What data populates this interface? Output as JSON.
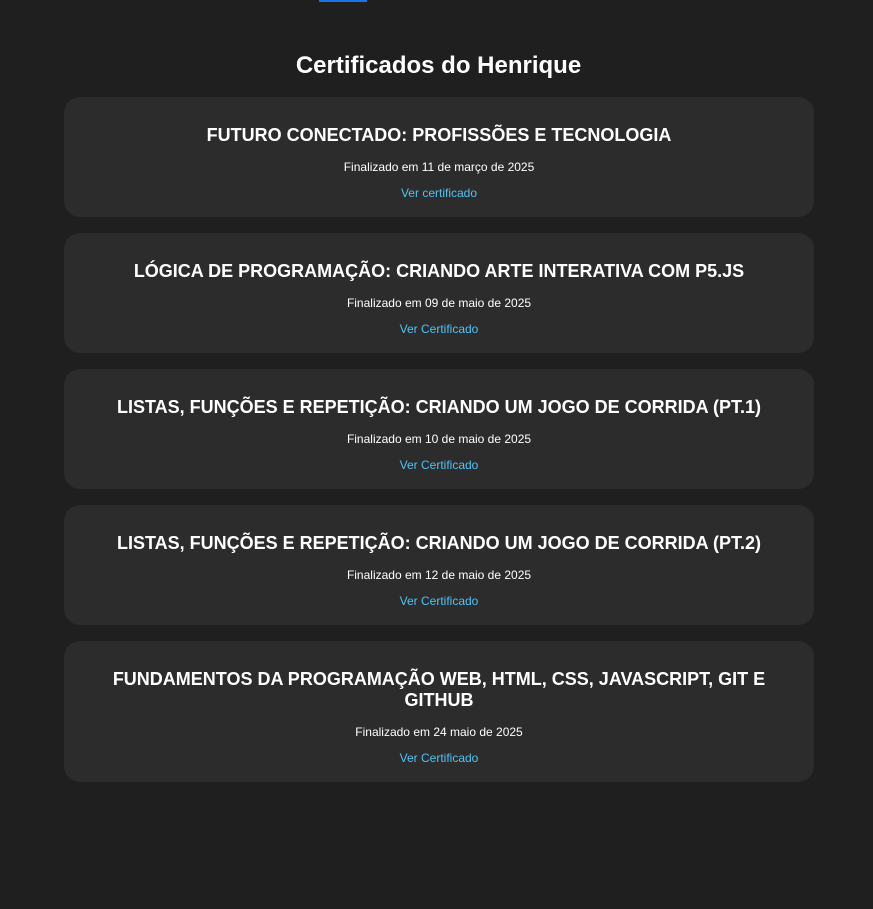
{
  "page": {
    "title": "Certificados do Henrique"
  },
  "colors": {
    "background": "#1f1f1f",
    "card": "#2c2c2c",
    "link": "#4fc3f7",
    "accent": "#1a73e8"
  },
  "certificates": [
    {
      "title": "FUTURO CONECTADO: PROFISSÕES E TECNOLOGIA",
      "date": "Finalizado em 11 de março de 2025",
      "link_label": "Ver certificado"
    },
    {
      "title": "LÓGICA DE PROGRAMAÇÃO: CRIANDO ARTE INTERATIVA COM P5.JS",
      "date": "Finalizado em 09 de maio de 2025",
      "link_label": "Ver Certificado"
    },
    {
      "title": "LISTAS, FUNÇÕES E REPETIÇÃO: CRIANDO UM JOGO DE CORRIDA (PT.1)",
      "date": "Finalizado em 10 de maio de 2025",
      "link_label": "Ver Certificado"
    },
    {
      "title": "LISTAS, FUNÇÕES E REPETIÇÃO: CRIANDO UM JOGO DE CORRIDA (PT.2)",
      "date": "Finalizado em 12 de maio de 2025",
      "link_label": "Ver Certificado"
    },
    {
      "title": "FUNDAMENTOS DA PROGRAMAÇÃO WEB, HTML, CSS, JAVASCRIPT, GIT E GITHUB",
      "date": "Finalizado em 24 maio de 2025",
      "link_label": "Ver Certificado"
    }
  ]
}
